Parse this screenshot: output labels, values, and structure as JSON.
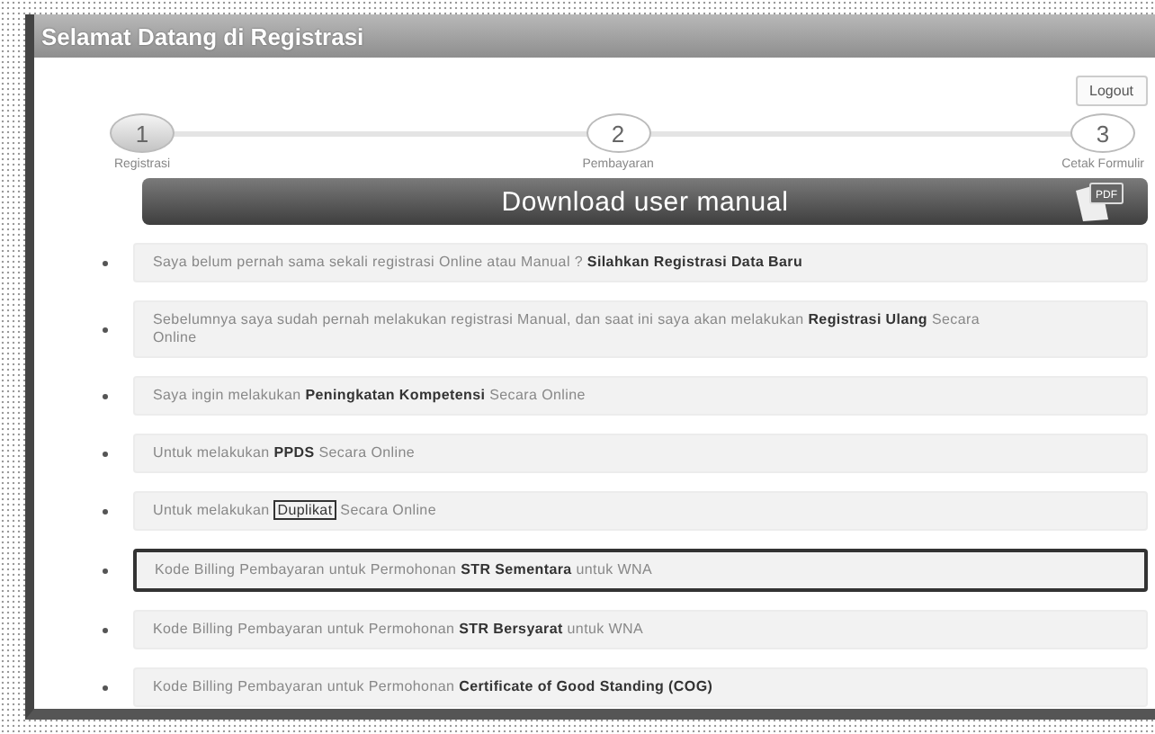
{
  "window": {
    "title": "Selamat Datang di Registrasi"
  },
  "logout_button": "Logout",
  "steps": [
    {
      "number": "1",
      "label": "Registrasi",
      "selected": true
    },
    {
      "number": "2",
      "label": "Pembayaran",
      "selected": false
    },
    {
      "number": "3",
      "label": "Cetak Formulir",
      "selected": false
    }
  ],
  "banner": {
    "text": "Download user manual",
    "badge": "PDF"
  },
  "items": [
    {
      "highlighted": false,
      "parts": [
        {
          "text": "Saya belum pernah sama sekali registrasi Online atau Manual ? ",
          "kind": "plain"
        },
        {
          "text": "Silahkan Registrasi Data Baru",
          "kind": "bold"
        }
      ]
    },
    {
      "highlighted": false,
      "parts": [
        {
          "text": "Sebelumnya saya sudah pernah melakukan registrasi Manual, dan saat ini saya akan melakukan ",
          "kind": "plain"
        },
        {
          "text": "Registrasi Ulang",
          "kind": "bold"
        },
        {
          "text": " Secara Online",
          "kind": "plain"
        }
      ]
    },
    {
      "highlighted": false,
      "parts": [
        {
          "text": "Saya ingin melakukan ",
          "kind": "plain"
        },
        {
          "text": "Peningkatan Kompetensi",
          "kind": "bold"
        },
        {
          "text": " Secara Online",
          "kind": "plain"
        }
      ]
    },
    {
      "highlighted": false,
      "parts": [
        {
          "text": "Untuk melakukan ",
          "kind": "plain"
        },
        {
          "text": "PPDS",
          "kind": "bold"
        },
        {
          "text": " Secara Online",
          "kind": "plain"
        }
      ]
    },
    {
      "highlighted": false,
      "parts": [
        {
          "text": "Untuk melakukan ",
          "kind": "plain"
        },
        {
          "text": "Duplikat",
          "kind": "boxed"
        },
        {
          "text": " Secara Online",
          "kind": "plain"
        }
      ]
    },
    {
      "highlighted": true,
      "parts": [
        {
          "text": "Kode Billing Pembayaran untuk Permohonan ",
          "kind": "plain"
        },
        {
          "text": "STR Sementara",
          "kind": "bold"
        },
        {
          "text": " untuk WNA",
          "kind": "plain"
        }
      ]
    },
    {
      "highlighted": false,
      "parts": [
        {
          "text": "Kode Billing Pembayaran untuk Permohonan ",
          "kind": "plain"
        },
        {
          "text": "STR Bersyarat",
          "kind": "bold"
        },
        {
          "text": " untuk WNA",
          "kind": "plain"
        }
      ]
    },
    {
      "highlighted": false,
      "parts": [
        {
          "text": "Kode Billing Pembayaran untuk Permohonan ",
          "kind": "plain"
        },
        {
          "text": "Certificate of Good Standing (COG)",
          "kind": "bold"
        }
      ]
    }
  ]
}
